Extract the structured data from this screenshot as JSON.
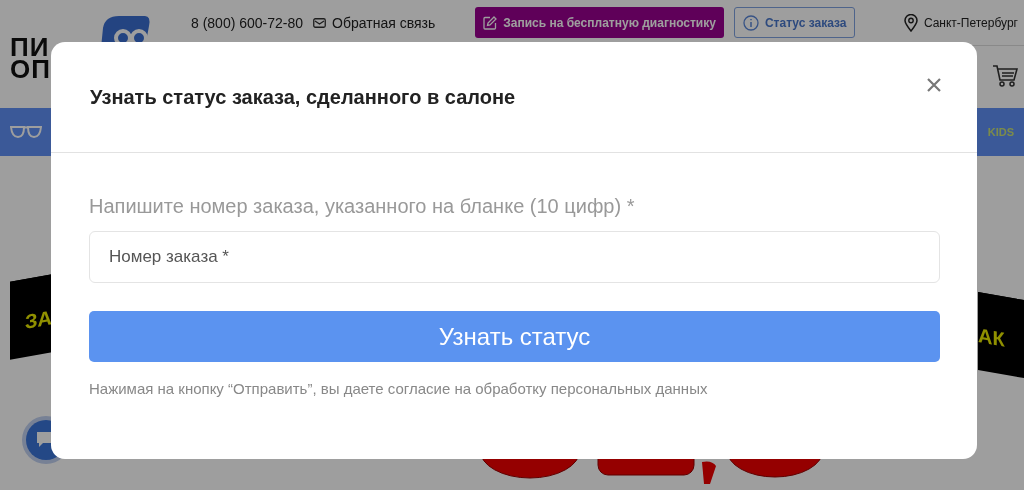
{
  "header": {
    "logo_lines": [
      "ПИ",
      "ОП"
    ],
    "phone": "8 (800) 600-72-80",
    "feedback_link": "Обратная связь",
    "diagnostics_button": "Запись на бесплатную диагностику",
    "order_status_button": "Статус заказа",
    "city": "Санкт-Петербург"
  },
  "nav": {
    "kids_label": "KIDS"
  },
  "banner": {
    "left_sticker": "ЗА",
    "right_sticker": "АК"
  },
  "modal": {
    "title": "Узнать статус заказа, сделанного в салоне",
    "label": "Напишите номер заказа, указанного на бланке (10 цифр) *",
    "input": {
      "placeholder": "Номер заказа *"
    },
    "submit_button": "Узнать статус",
    "consent_note": "Нажимая на кнопку “Отправить”, вы даете согласие на обработку персональных данных"
  }
}
